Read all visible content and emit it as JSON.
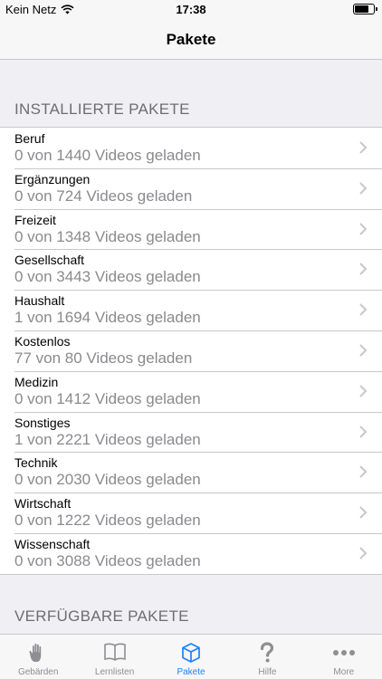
{
  "status_bar": {
    "carrier": "Kein Netz",
    "time": "17:38",
    "battery_level": 0.8
  },
  "nav": {
    "title": "Pakete"
  },
  "sections": {
    "installed_header": "INSTALLIERTE PAKETE",
    "available_header": "VERFÜGBARE PAKETE"
  },
  "installed_packages": [
    {
      "name": "Beruf",
      "status": "0 von 1440 Videos geladen"
    },
    {
      "name": "Ergänzungen",
      "status": "0 von 724 Videos geladen"
    },
    {
      "name": "Freizeit",
      "status": "0 von 1348 Videos geladen"
    },
    {
      "name": "Gesellschaft",
      "status": "0 von 3443 Videos geladen"
    },
    {
      "name": "Haushalt",
      "status": "1 von 1694 Videos geladen"
    },
    {
      "name": "Kostenlos",
      "status": "77 von 80 Videos geladen"
    },
    {
      "name": "Medizin",
      "status": "0 von 1412 Videos geladen"
    },
    {
      "name": "Sonstiges",
      "status": "1 von 2221 Videos geladen"
    },
    {
      "name": "Technik",
      "status": "0 von 2030 Videos geladen"
    },
    {
      "name": "Wirtschaft",
      "status": "0 von 1222 Videos geladen"
    },
    {
      "name": "Wissenschaft",
      "status": "0 von 3088 Videos geladen"
    }
  ],
  "tabs": [
    {
      "label": "Gebärden",
      "icon": "hand-icon"
    },
    {
      "label": "Lernlisten",
      "icon": "book-icon"
    },
    {
      "label": "Pakete",
      "icon": "box-icon",
      "active": true
    },
    {
      "label": "Hilfe",
      "icon": "question-icon"
    },
    {
      "label": "More",
      "icon": "more-icon"
    }
  ],
  "colors": {
    "accent": "#1a82ff",
    "inactive_tab": "#8e8e93",
    "background": "#efeff4",
    "secondary_text": "#8a8a8f"
  }
}
